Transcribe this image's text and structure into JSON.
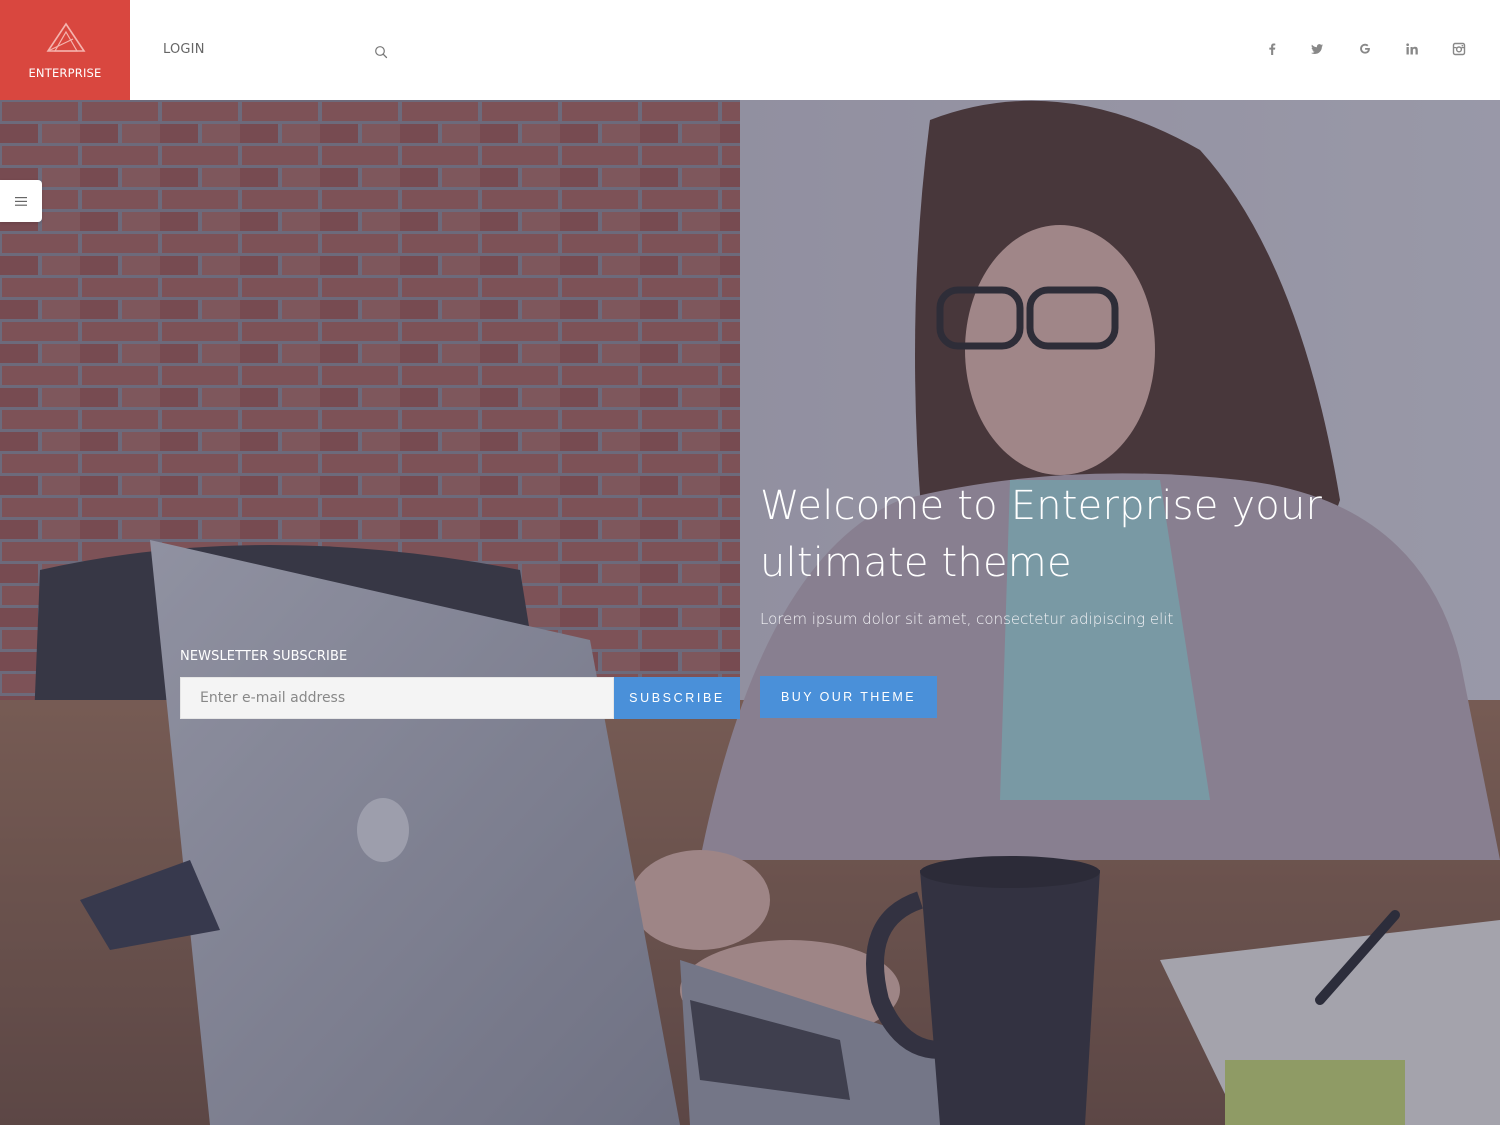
{
  "brand": {
    "name": "ENTERPRISE",
    "color": "#d9473f"
  },
  "header": {
    "login_label": "LOGIN",
    "search_icon": "search-icon",
    "social": [
      "facebook-icon",
      "twitter-icon",
      "google-icon",
      "linkedin-icon",
      "instagram-icon"
    ]
  },
  "sidebar": {
    "toggle_icon": "hamburger-menu-icon"
  },
  "hero": {
    "title": "Welcome to Enterprise your ultimate theme",
    "subtitle": "Lorem ipsum dolor sit amet, consectetur adipiscing elit",
    "cta_label": "BUY OUR THEME",
    "accent": "#4a90d9"
  },
  "newsletter": {
    "label": "NEWSLETTER SUBSCRIBE",
    "placeholder": "Enter e-mail address",
    "button_label": "SUBSCRIBE"
  }
}
